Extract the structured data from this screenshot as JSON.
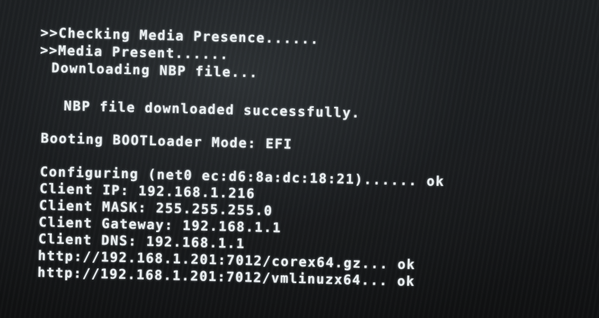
{
  "console": {
    "lines": [
      ">>Checking Media Presence......",
      ">>Media Present......",
      " Downloading NBP file...",
      "  NBP file downloaded successfully.",
      "Booting BOOTLoader Mode: EFI",
      "Configuring (net0 ec:d6:8a:dc:18:21)...... ok",
      "Client IP: 192.168.1.216",
      "Client MASK: 255.255.255.0",
      "Client Gateway: 192.168.1.1",
      "Client DNS: 192.168.1.1",
      "http://192.168.1.201:7012/corex64.gz... ok",
      "http://192.168.1.201:7012/vmlinuzx64... ok"
    ]
  }
}
